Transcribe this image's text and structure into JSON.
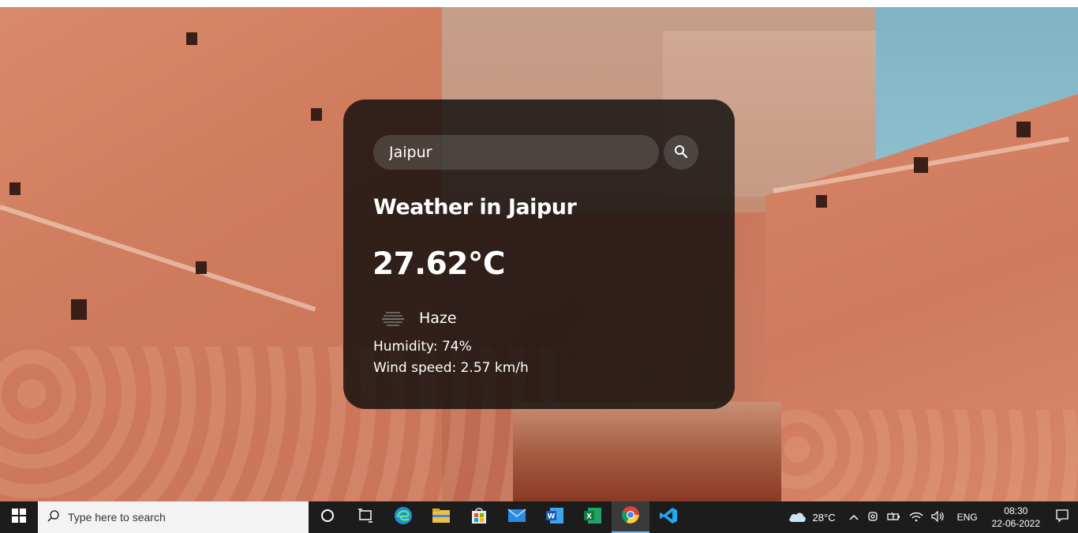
{
  "weather_app": {
    "search": {
      "value": "Jaipur",
      "placeholder": "Search"
    },
    "title": "Weather in Jaipur",
    "temperature": "27.62°C",
    "condition": "Haze",
    "condition_icon": "haze-icon",
    "humidity": "Humidity: 74%",
    "wind": "Wind speed: 2.57 km/h"
  },
  "taskbar": {
    "search_placeholder": "Type here to search",
    "apps": [
      "task-view",
      "edge",
      "file-explorer",
      "microsoft-store",
      "mail",
      "word",
      "excel",
      "chrome",
      "vscode"
    ],
    "weather_temp": "28°C",
    "language": "ENG",
    "time": "08:30",
    "date": "22-06-2022"
  },
  "colors": {
    "card_bg": "#0a0a0a",
    "taskbar_bg": "#1c1c1c",
    "accent": "#76b9ed"
  }
}
